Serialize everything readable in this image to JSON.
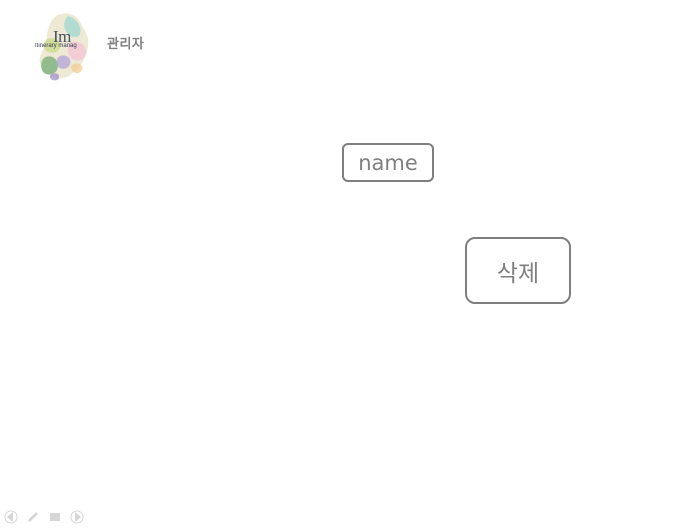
{
  "header": {
    "logo_mark": "Im",
    "logo_subtitle": "Itinerary manag",
    "logo_icon": "korea-map-logo-icon",
    "admin_label": "관리자"
  },
  "main": {
    "name_field_label": "name",
    "delete_button_label": "삭제"
  },
  "slideshow_controls": {
    "icons": [
      "previous-icon",
      "pen-icon",
      "menu-icon",
      "next-icon"
    ]
  },
  "colors": {
    "text_gray": "#7f7f7f",
    "border_gray": "#7f7f7f",
    "background": "#ffffff"
  }
}
